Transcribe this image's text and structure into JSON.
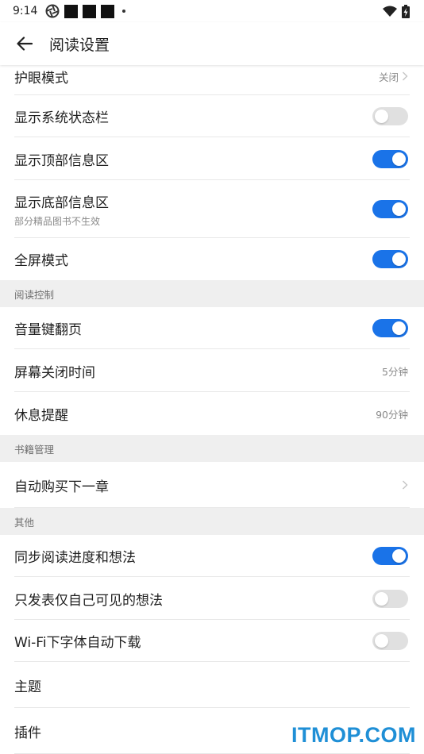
{
  "status_bar": {
    "time": "9:14"
  },
  "app_bar": {
    "title": "阅读设置"
  },
  "rows": {
    "eye_mode": {
      "label": "护眼模式",
      "value": "关闭"
    },
    "system_status_bar": {
      "label": "显示系统状态栏",
      "toggle": false
    },
    "top_info": {
      "label": "显示顶部信息区",
      "toggle": true
    },
    "bottom_info": {
      "label": "显示底部信息区",
      "sub": "部分精品图书不生效",
      "toggle": true
    },
    "fullscreen": {
      "label": "全屏模式",
      "toggle": true
    },
    "volume_page": {
      "label": "音量键翻页",
      "toggle": true
    },
    "screen_off": {
      "label": "屏幕关闭时间",
      "value": "5分钟"
    },
    "rest_reminder": {
      "label": "休息提醒",
      "value": "90分钟"
    },
    "auto_buy": {
      "label": "自动购买下一章"
    },
    "sync_progress": {
      "label": "同步阅读进度和想法",
      "toggle": true
    },
    "private_thoughts": {
      "label": "只发表仅自己可见的想法",
      "toggle": false
    },
    "wifi_font": {
      "label": "Wi-Fi下字体自动下载",
      "toggle": false
    },
    "theme": {
      "label": "主题"
    },
    "plugins": {
      "label": "插件"
    }
  },
  "sections": {
    "reading_control": "阅读控制",
    "book_management": "书籍管理",
    "other": "其他"
  },
  "watermark": "ITMOP.COM",
  "colors": {
    "accent": "#1a73e8",
    "toggle_off": "#e0e0e0",
    "section_bg": "#efefef",
    "watermark": "#1f8fd6"
  }
}
